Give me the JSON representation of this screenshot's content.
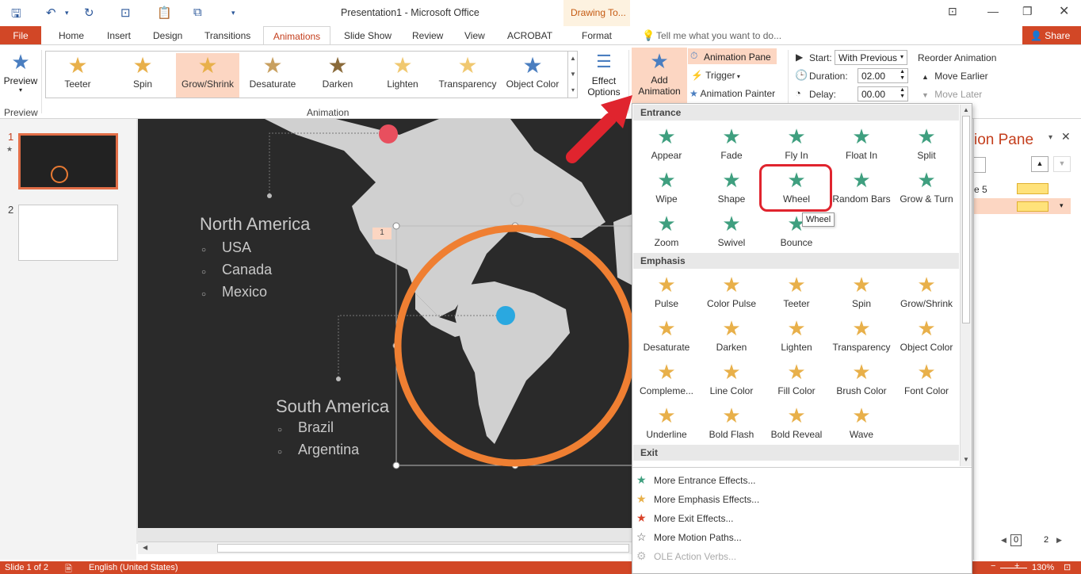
{
  "titlebar": {
    "title": "Presentation1 - Microsoft Office",
    "context_tab": "Drawing To..."
  },
  "tabs": {
    "file": "File",
    "items": [
      "Home",
      "Insert",
      "Design",
      "Transitions",
      "Animations",
      "Slide Show",
      "Review",
      "View",
      "ACROBAT",
      "Format"
    ],
    "tell_me": "Tell me what you want to do...",
    "share": "Share"
  },
  "ribbon": {
    "preview_label": "Preview",
    "preview_group": "Preview",
    "animation_group": "Animation",
    "gallery": [
      {
        "label": "Teeter",
        "color": "#e8b04a"
      },
      {
        "label": "Spin",
        "color": "#e8b04a"
      },
      {
        "label": "Grow/Shrink",
        "color": "#e8b04a"
      },
      {
        "label": "Desaturate",
        "color": "#c8a060"
      },
      {
        "label": "Darken",
        "color": "#8a6a3a"
      },
      {
        "label": "Lighten",
        "color": "#f0c870"
      },
      {
        "label": "Transparency",
        "color": "#f0c870"
      },
      {
        "label": "Object Color",
        "color": "#4a7ec0"
      }
    ],
    "effect_options": [
      "Effect",
      "Options"
    ],
    "add_animation": [
      "Add",
      "Animation"
    ],
    "animation_pane": "Animation Pane",
    "trigger": "Trigger",
    "animation_painter": "Animation Painter",
    "start_label": "Start:",
    "start_value": "With Previous",
    "duration_label": "Duration:",
    "duration_value": "02.00",
    "delay_label": "Delay:",
    "delay_value": "00.00",
    "reorder": "Reorder Animation",
    "move_earlier": "Move Earlier",
    "move_later": "Move Later"
  },
  "thumbs": {
    "slide1": "1",
    "slide2": "2"
  },
  "slide": {
    "north_america": "North America",
    "na_items": [
      "USA",
      "Canada",
      "Mexico"
    ],
    "south_america": "South America",
    "sa_items": [
      "Brazil",
      "Argentina"
    ],
    "anim_tag": "1"
  },
  "animpane": {
    "title": "ion Pane",
    "item1": "e 5"
  },
  "dropdown": {
    "entrance_header": "Entrance",
    "entrance": [
      {
        "label": "Appear"
      },
      {
        "label": "Fade"
      },
      {
        "label": "Fly In"
      },
      {
        "label": "Float In"
      },
      {
        "label": "Split"
      },
      {
        "label": "Wipe"
      },
      {
        "label": "Shape"
      },
      {
        "label": "Wheel"
      },
      {
        "label": "Random Bars"
      },
      {
        "label": "Grow & Turn"
      },
      {
        "label": "Zoom"
      },
      {
        "label": "Swivel"
      },
      {
        "label": "Bounce"
      }
    ],
    "emphasis_header": "Emphasis",
    "emphasis": [
      {
        "label": "Pulse"
      },
      {
        "label": "Color Pulse"
      },
      {
        "label": "Teeter"
      },
      {
        "label": "Spin"
      },
      {
        "label": "Grow/Shrink"
      },
      {
        "label": "Desaturate"
      },
      {
        "label": "Darken"
      },
      {
        "label": "Lighten"
      },
      {
        "label": "Transparency"
      },
      {
        "label": "Object Color"
      },
      {
        "label": "Compleme..."
      },
      {
        "label": "Line Color"
      },
      {
        "label": "Fill Color"
      },
      {
        "label": "Brush Color"
      },
      {
        "label": "Font Color"
      },
      {
        "label": "Underline"
      },
      {
        "label": "Bold Flash"
      },
      {
        "label": "Bold Reveal"
      },
      {
        "label": "Wave"
      }
    ],
    "exit_header": "Exit",
    "tooltip": "Wheel",
    "more_entrance": "More Entrance Effects...",
    "more_emphasis": "More Emphasis Effects...",
    "more_exit": "More Exit Effects...",
    "more_motion": "More Motion Paths...",
    "ole": "OLE Action Verbs..."
  },
  "status": {
    "slide": "Slide 1 of 2",
    "language": "English (United States)",
    "zoom": "130%"
  },
  "pager": {
    "current": "0",
    "total": "2"
  },
  "colors": {
    "accent": "#d24726",
    "entrance_star": "#3f9f7f",
    "emphasis_star": "#e8b04a",
    "highlight": "#e0242e"
  }
}
